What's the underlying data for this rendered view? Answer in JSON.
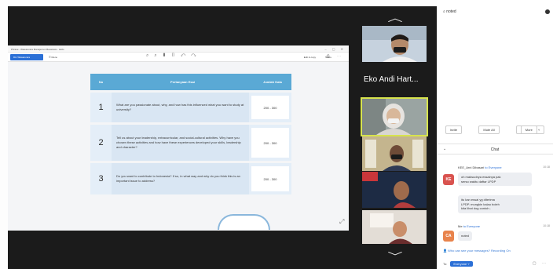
{
  "shared_window": {
    "title": "Phrase - Wawancara Manajemen Beasiswa - Hello",
    "toolbar": {
      "active_tab": "Dtc Wawancara",
      "menu": "Menu",
      "right_1": "Edit & copy",
      "right_2": "Share"
    }
  },
  "question_table": {
    "headers": {
      "no": "No",
      "question": "Pertanyaan Esai",
      "words": "Jumlah Kata"
    },
    "rows": [
      {
        "no": "1",
        "question": "What are you passionate about, why, and how has this influenced what you want to study at university?",
        "words": "200 - 300"
      },
      {
        "no": "2",
        "question": "Tell us about your leadership, extracurricular, and social-cultural activities. Why have you chosen these activities and how have these experiences developed your skills, leadership and character?",
        "words": "200 - 300"
      },
      {
        "no": "3",
        "question": "Do you want to contribute to Indonesia? If so, in what way and why do you think this is an important issue to address?",
        "words": "200 - 300"
      }
    ]
  },
  "videos": {
    "active_speaker_name": "Eko Andi Hart..."
  },
  "panel": {
    "search": "noted",
    "participant_buttons": {
      "invite": "Invite",
      "mute_all": "Mute All",
      "more": "More"
    },
    "chat": {
      "title": "Chat",
      "messages": [
        {
          "initials": "KE",
          "avatar_color": "#d9534f",
          "sender": "KEE_Arni Dibasari",
          "to_label": "to Everyone",
          "time": "10:18",
          "lines": [
            "oh maksudnya essainya pak",
            "serso waktu daftar LPDP"
          ]
        },
        {
          "lines": [
            "itu kan essai yg diterima",
            "LPDP. mungkin kalau boleh",
            "kita lihat dog contoh.."
          ]
        },
        {
          "initials": "CA",
          "avatar_color": "#e8834c",
          "sender": "Me",
          "to_label": "to Everyone",
          "time": "10:18",
          "lines": [
            "noted"
          ]
        }
      ],
      "compose_placeholder": "Who can see your messages? Recording On",
      "to_label": "To:",
      "to_value": "Everyone"
    }
  }
}
